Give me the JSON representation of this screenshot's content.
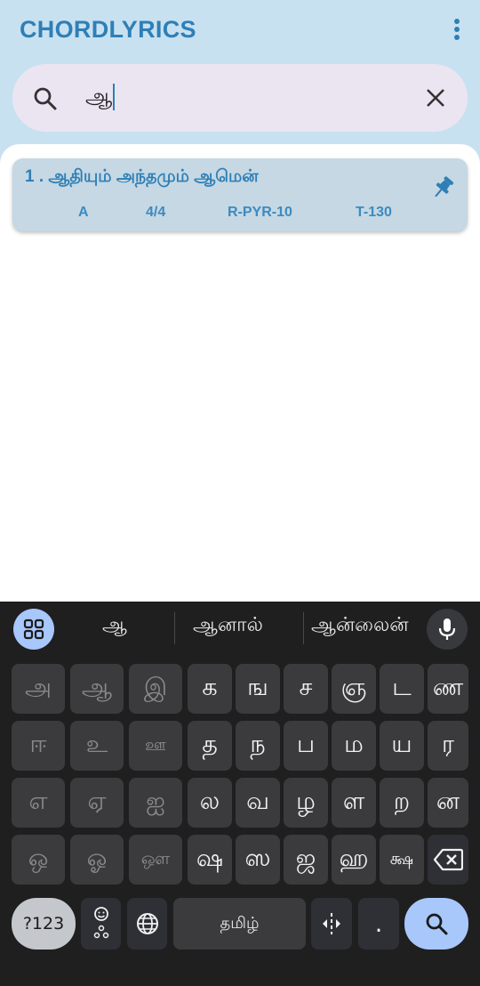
{
  "app": {
    "title": "CHORDLYRICS"
  },
  "search": {
    "query": "ஆ"
  },
  "results": [
    {
      "title": "1 . ஆதியும் அந்தமும் ஆமென்",
      "key": "A",
      "time_signature": "4/4",
      "rhythm": "R-PYR-10",
      "tempo": "T-130"
    }
  ],
  "keyboard": {
    "suggestions": [
      "ஆ",
      "ஆனால்",
      "ஆன்லைன்"
    ],
    "row1": [
      "அ",
      "ஆ",
      "இ",
      "க",
      "ங",
      "ச",
      "ஞ",
      "ட",
      "ண"
    ],
    "row2": [
      "ஈ",
      "உ",
      "ஊ",
      "த",
      "ந",
      "ப",
      "ம",
      "ய",
      "ர"
    ],
    "row3": [
      "எ",
      "ஏ",
      "ஐ",
      "ல",
      "வ",
      "ழ",
      "ள",
      "ற",
      "ன"
    ],
    "row4": [
      "ஒ",
      "ஓ",
      "ஔ",
      "ஷ",
      "ஸ",
      "ஜ",
      "ஹ",
      "க்ஷ"
    ],
    "symbols_label": "?123",
    "space_label": "தமிழ்",
    "period_label": "."
  },
  "colors": {
    "accent": "#2f7fb6",
    "header_bg": "#c8e1f0",
    "card_bg": "#c5d8e3",
    "keyboard_bg": "#1f1f20"
  }
}
